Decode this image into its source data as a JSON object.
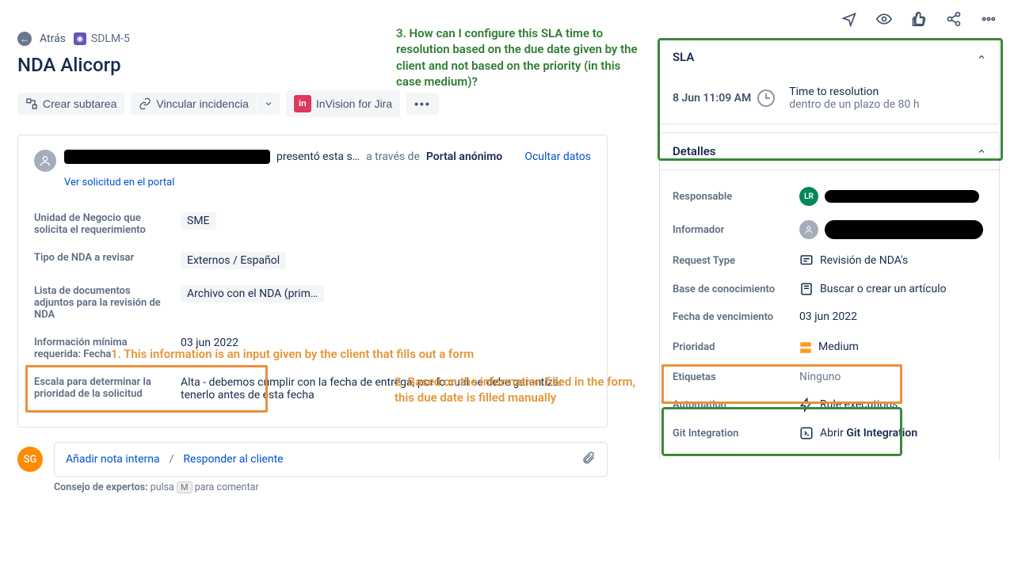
{
  "breadcrumbs": {
    "back": "Atrás",
    "key": "SDLM-5"
  },
  "title": "NDA Alicorp",
  "toolbar": {
    "subtask": "Crear subtarea",
    "link": "Vincular incidencia",
    "invision": "InVision for Jira"
  },
  "annotations": {
    "q3": "3. How can I configure this SLA time to resolution based on the due date given by the client and not based on the priority (in this case medium)?",
    "q1": "1. This information is an input given by the client that fills out a form",
    "q2": "2. Based on the information filled in the form, this due date is filled manually"
  },
  "request": {
    "submitted": "presentó esta s…",
    "via_label": "a través de",
    "via_value": "Portal anónimo",
    "hide": "Ocultar datos",
    "portal_link": "Ver solicitud en el portal",
    "fields": {
      "bu_label": "Unidad de Negocio que solicita el requerimiento",
      "bu_value": "SME",
      "type_label": "Tipo de NDA a revisar",
      "type_value": "Externos / Español",
      "docs_label": "Lista de documentos adjuntos para la revisión de NDA",
      "docs_value": "Archivo con el NDA (prim…",
      "min_label": "Información mínima requerida: Fecha",
      "min_value": "03 jun 2022",
      "scale_label": "Escala para determinar la prioridad de la solicitud",
      "scale_value": "Alta - debemos cumplir con la fecha de entrega, por lo cual se debe garantizar tenerlo antes de esta fecha"
    }
  },
  "comment": {
    "avatar": "SG",
    "internal": "Añadir nota interna",
    "reply": "Responder al cliente",
    "tip_prefix": "Consejo de expertos:",
    "tip_text": "pulsa",
    "tip_key": "M",
    "tip_suffix": "para comentar"
  },
  "sidebar": {
    "sla": {
      "title": "SLA",
      "date": "8 Jun 11:09 AM",
      "t1": "Time to resolution",
      "t2": "dentro de un plazo de 80 h"
    },
    "details": {
      "title": "Detalles",
      "assignee_label": "Responsable",
      "assignee_initials": "LR",
      "reporter_label": "Informador",
      "reqtype_label": "Request Type",
      "reqtype_value": "Revisión de NDA's",
      "kb_label": "Base de conocimiento",
      "kb_value": "Buscar o crear un artículo",
      "due_label": "Fecha de vencimiento",
      "due_value": "03 jun 2022",
      "priority_label": "Prioridad",
      "priority_value": "Medium",
      "labels_label": "Etiquetas",
      "labels_value": "Ninguno",
      "automation_label": "Automation",
      "automation_value": "Rule executions",
      "git_label": "Git Integration",
      "git_prefix": "Abrir ",
      "git_bold": "Git Integration"
    }
  }
}
